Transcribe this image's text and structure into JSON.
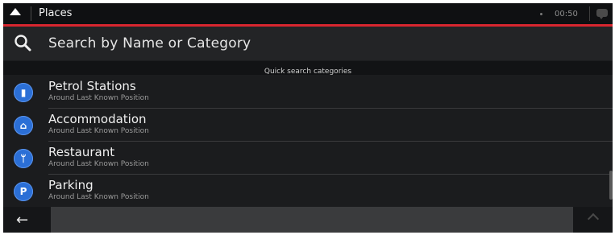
{
  "titlebar": {
    "title": "Places",
    "clock": "00:50",
    "icons": [
      "back-arrow-icon",
      "gps-icon",
      "message-icon"
    ]
  },
  "search": {
    "placeholder": "Search by Name or Category",
    "icon": "search-icon"
  },
  "section_header": "Quick search categories",
  "categories": [
    {
      "name": "Petrol Stations",
      "subtitle": "Around Last Known Position",
      "icon": "fuel-pump-icon",
      "glyph": "▮"
    },
    {
      "name": "Accommodation",
      "subtitle": "Around Last Known Position",
      "icon": "bed-icon",
      "glyph": "⌂"
    },
    {
      "name": "Restaurant",
      "subtitle": "Around Last Known Position",
      "icon": "cutlery-icon",
      "glyph": "ᛘ"
    },
    {
      "name": "Parking",
      "subtitle": "Around Last Known Position",
      "icon": "parking-icon",
      "glyph": "P"
    }
  ],
  "bottombar": {
    "back_icon": "left-arrow-icon",
    "back_glyph": "←",
    "up_icon": "chevron-up-icon"
  },
  "colors": {
    "accent_red": "#d8262f",
    "icon_blue": "#2b6fd6",
    "background": "#1b1c1e"
  }
}
